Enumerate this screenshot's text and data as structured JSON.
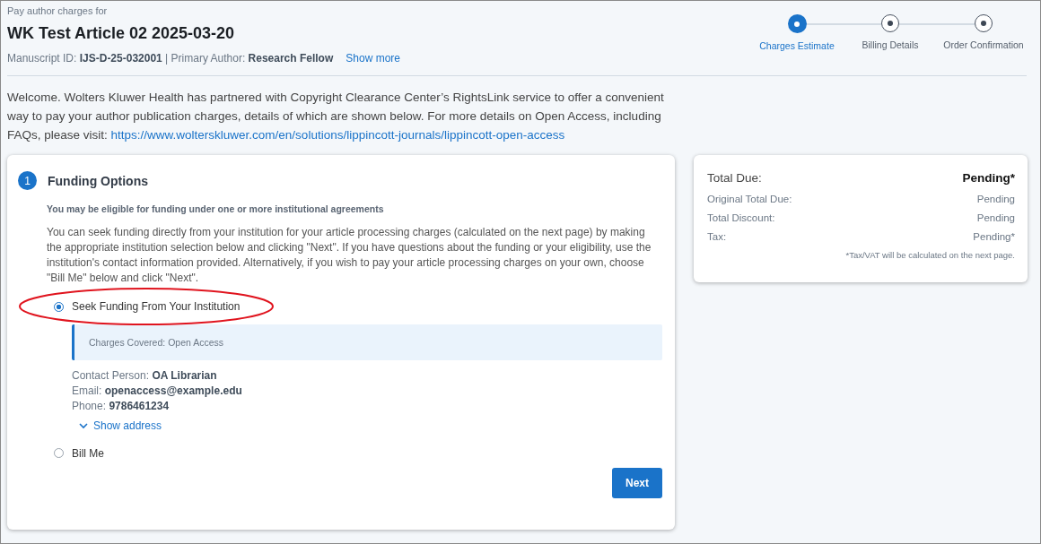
{
  "header": {
    "eyebrow": "Pay author charges for",
    "title": "WK Test Article 02 2025-03-20",
    "meta": "Manuscript ID: **IJS-D-25-032001** | Primary Author: **Research Fellow**",
    "show_more": "Show more"
  },
  "steps": [
    {
      "label": "Charges Estimate",
      "selected": true
    },
    {
      "label": "Billing Details",
      "selected": false
    },
    {
      "label": "Order Confirmation",
      "selected": false
    }
  ],
  "welcome": {
    "text": "Welcome. Wolters Kluwer Health has partnered with Copyright Clearance Center’s RightsLink service to offer a convenient way to pay your author publication charges, details of which are shown below. For more details on Open Access, including FAQs, please visit:",
    "link": "https://www.wolterskluwer.com/en/solutions/lippincott-journals/lippincott-open-access"
  },
  "funding": {
    "number": "1",
    "title": "Funding Options",
    "subtitle": "You may be eligible for funding under one or more institutional agreements",
    "description": "You can seek funding directly from your institution for your article processing charges (calculated on the next page) by making the appropriate institution selection below and clicking \"Next\". If you have questions about the funding or your eligibility, use the institution's contact information provided. Alternatively, if you wish to pay your article processing charges on your own, choose \"Bill Me\" below and click \"Next\".",
    "options": [
      {
        "label": "Seek Funding From Your Institution",
        "selected": true,
        "highlighted": true,
        "notice": "Charges Covered: Open Access",
        "contact": [
          "Contact Person: **OA Librarian**",
          "Email: **openaccess@example.edu**",
          "Phone: **9786461234**"
        ],
        "show_address": "Show address"
      },
      {
        "label": "Bill Me",
        "selected": false,
        "highlighted": false
      }
    ],
    "next": "Next"
  },
  "summary": {
    "rows": [
      {
        "label": "Total Due:",
        "value": "Pending*",
        "kind": "total"
      },
      {
        "label": "Original Total Due:",
        "value": "Pending",
        "kind": "line"
      },
      {
        "label": "Total Discount:",
        "value": "Pending",
        "kind": "line"
      },
      {
        "label": "Tax:",
        "value": "Pending*",
        "kind": "line"
      }
    ],
    "note": "*Tax/VAT will be calculated on the next page."
  }
}
